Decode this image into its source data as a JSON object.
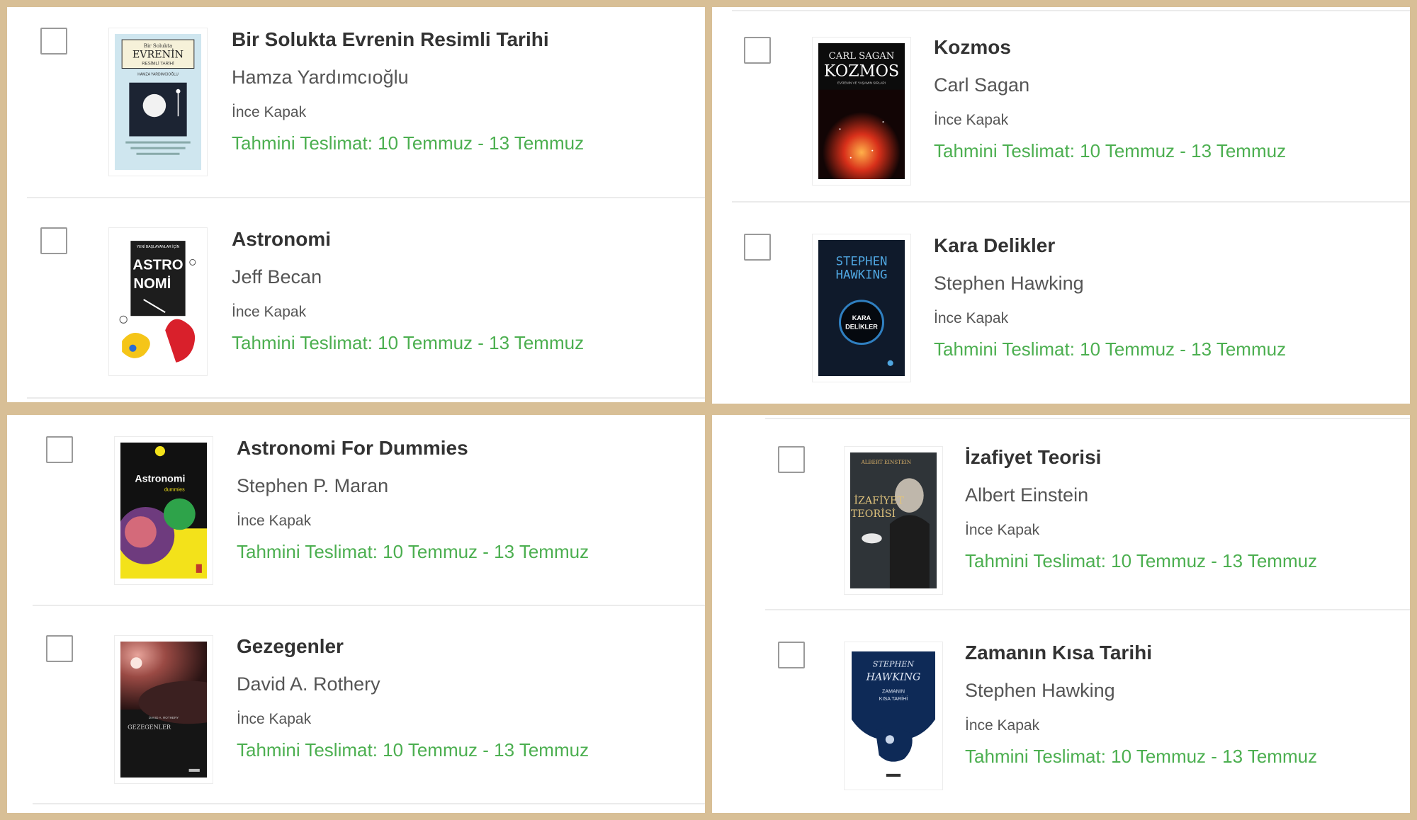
{
  "binding_label": "İnce Kapak",
  "delivery_label": "Tahmini Teslimat: 10 Temmuz - 13 Temmuz",
  "colors": {
    "border": "#d8bf96",
    "delivery": "#4caf50",
    "title": "#333333"
  },
  "books": [
    {
      "title": "Bir Solukta Evrenin Resimli Tarihi",
      "author": "Hamza Yardımcıoğlu",
      "cover": {
        "line1": "Bir Solukta",
        "line2": "EVRENİN",
        "line3": "RESİMLİ TARİHİ",
        "line4": "HAMZA YARDIMCIOĞLU"
      }
    },
    {
      "title": "Astronomi",
      "author": "Jeff Becan",
      "cover": {
        "line1": "YENİ BAŞLAYANLAR İÇİN",
        "line2": "ASTRO",
        "line3": "NOMİ"
      }
    },
    {
      "title": "Kozmos",
      "author": "Carl Sagan",
      "cover": {
        "line1": "CARL SAGAN",
        "line2": "KOZMOS",
        "line3": "EVRENİN VE YAŞAMIN SIRLARI"
      }
    },
    {
      "title": "Kara Delikler",
      "author": "Stephen Hawking",
      "cover": {
        "line1": "STEPHEN",
        "line2": "HAWKING",
        "line3": "KARA",
        "line4": "DELİKLER"
      }
    },
    {
      "title": "Astronomi For Dummies",
      "author": "Stephen P. Maran",
      "cover": {
        "line1": "Astronomi",
        "line2": "dummies"
      }
    },
    {
      "title": "Gezegenler",
      "author": "David A. Rothery",
      "cover": {
        "line1": "DAVID A. ROTHERY",
        "line2": "GEZEGENLER"
      }
    },
    {
      "title": "İzafiyet Teorisi",
      "author": "Albert Einstein",
      "cover": {
        "line1": "ALBERT EINSTEIN",
        "line2": "İZAFİYET",
        "line3": "TEORİSİ"
      }
    },
    {
      "title": "Zamanın Kısa Tarihi",
      "author": "Stephen Hawking",
      "cover": {
        "line1": "STEPHEN",
        "line2": "HAWKING",
        "line3": "ZAMANIN",
        "line4": "KISA TARİHİ"
      }
    }
  ]
}
